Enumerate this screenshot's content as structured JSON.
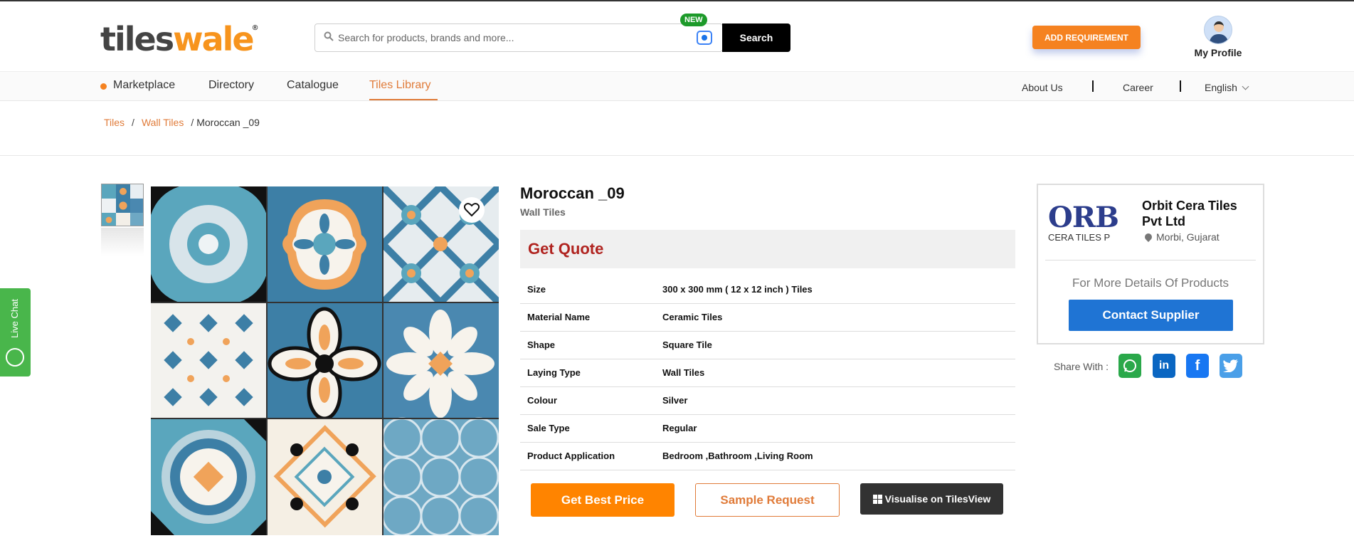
{
  "header": {
    "logo_part1": "tiles",
    "logo_part2": "wale",
    "logo_mark": "®",
    "search_placeholder": "Search for products, brands and more...",
    "new_badge": "NEW",
    "search_button": "Search",
    "add_requirement": "ADD REQUIREMENT",
    "profile_label": "My Profile"
  },
  "nav": {
    "left": [
      "Marketplace",
      "Directory",
      "Catalogue",
      "Tiles Library"
    ],
    "active": "Tiles Library",
    "right": [
      "About Us",
      "Career",
      "English"
    ]
  },
  "breadcrumb": [
    "Tiles",
    "Wall Tiles",
    "Moroccan _09"
  ],
  "product": {
    "title": "Moroccan _09",
    "category": "Wall Tiles",
    "get_quote": "Get Quote",
    "specs": [
      {
        "key": "Size",
        "value": "300 x 300 mm ( 12 x 12 inch ) Tiles"
      },
      {
        "key": "Material Name",
        "value": "Ceramic Tiles"
      },
      {
        "key": "Shape",
        "value": "Square Tile"
      },
      {
        "key": "Laying Type",
        "value": "Wall Tiles"
      },
      {
        "key": "Colour",
        "value": "Silver"
      },
      {
        "key": "Sale Type",
        "value": "Regular"
      },
      {
        "key": "Product Application",
        "value": "Bedroom ,Bathroom ,Living Room"
      }
    ],
    "buttons": {
      "best_price": "Get Best Price",
      "sample": "Sample Request",
      "visualise": "Visualise on TilesView"
    }
  },
  "supplier": {
    "logo_big": "ORB",
    "logo_small": "CERA TILES P",
    "name": "Orbit Cera Tiles Pvt Ltd",
    "location": "Morbi, Gujarat",
    "more_details": "For More Details Of Products",
    "contact": "Contact Supplier",
    "share_label": "Share With :",
    "share_icons": [
      "whatsapp-icon",
      "linkedin-icon",
      "facebook-icon",
      "twitter-icon"
    ]
  },
  "live_chat": "Live Chat",
  "colors": {
    "brand_orange": "#f58220",
    "link_orange": "#e07b39",
    "quote_red": "#b0231f",
    "contact_blue": "#1f74d4",
    "chat_green": "#49b64b",
    "tile_blue": "#3d7fa6",
    "tile_teal": "#5aa6bd",
    "tile_orange": "#f0a35a"
  }
}
